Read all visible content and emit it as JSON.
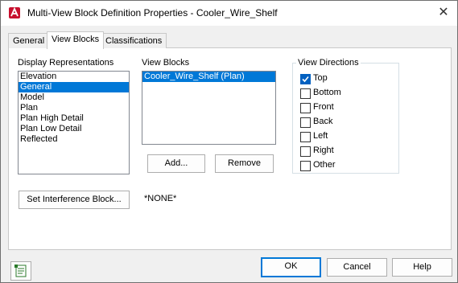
{
  "window": {
    "title": "Multi-View Block Definition Properties - Cooler_Wire_Shelf"
  },
  "tabs": [
    {
      "label": "General"
    },
    {
      "label": "View Blocks"
    },
    {
      "label": "Classifications"
    }
  ],
  "display_representations": {
    "label": "Display Representations",
    "items": [
      "Elevation",
      "General",
      "Model",
      "Plan",
      "Plan High Detail",
      "Plan Low Detail",
      "Reflected"
    ],
    "selected": "General"
  },
  "view_blocks": {
    "label": "View Blocks",
    "items": [
      "Cooler_Wire_Shelf (Plan)"
    ],
    "selected": "Cooler_Wire_Shelf (Plan)",
    "add_label": "Add...",
    "remove_label": "Remove"
  },
  "view_directions": {
    "label": "View Directions",
    "options": [
      {
        "label": "Top",
        "checked": true
      },
      {
        "label": "Bottom",
        "checked": false
      },
      {
        "label": "Front",
        "checked": false
      },
      {
        "label": "Back",
        "checked": false
      },
      {
        "label": "Left",
        "checked": false
      },
      {
        "label": "Right",
        "checked": false
      },
      {
        "label": "Other",
        "checked": false
      }
    ]
  },
  "interference": {
    "button_label": "Set Interference Block...",
    "value": "*NONE*"
  },
  "footer": {
    "ok_label": "OK",
    "cancel_label": "Cancel",
    "help_label": "Help"
  }
}
